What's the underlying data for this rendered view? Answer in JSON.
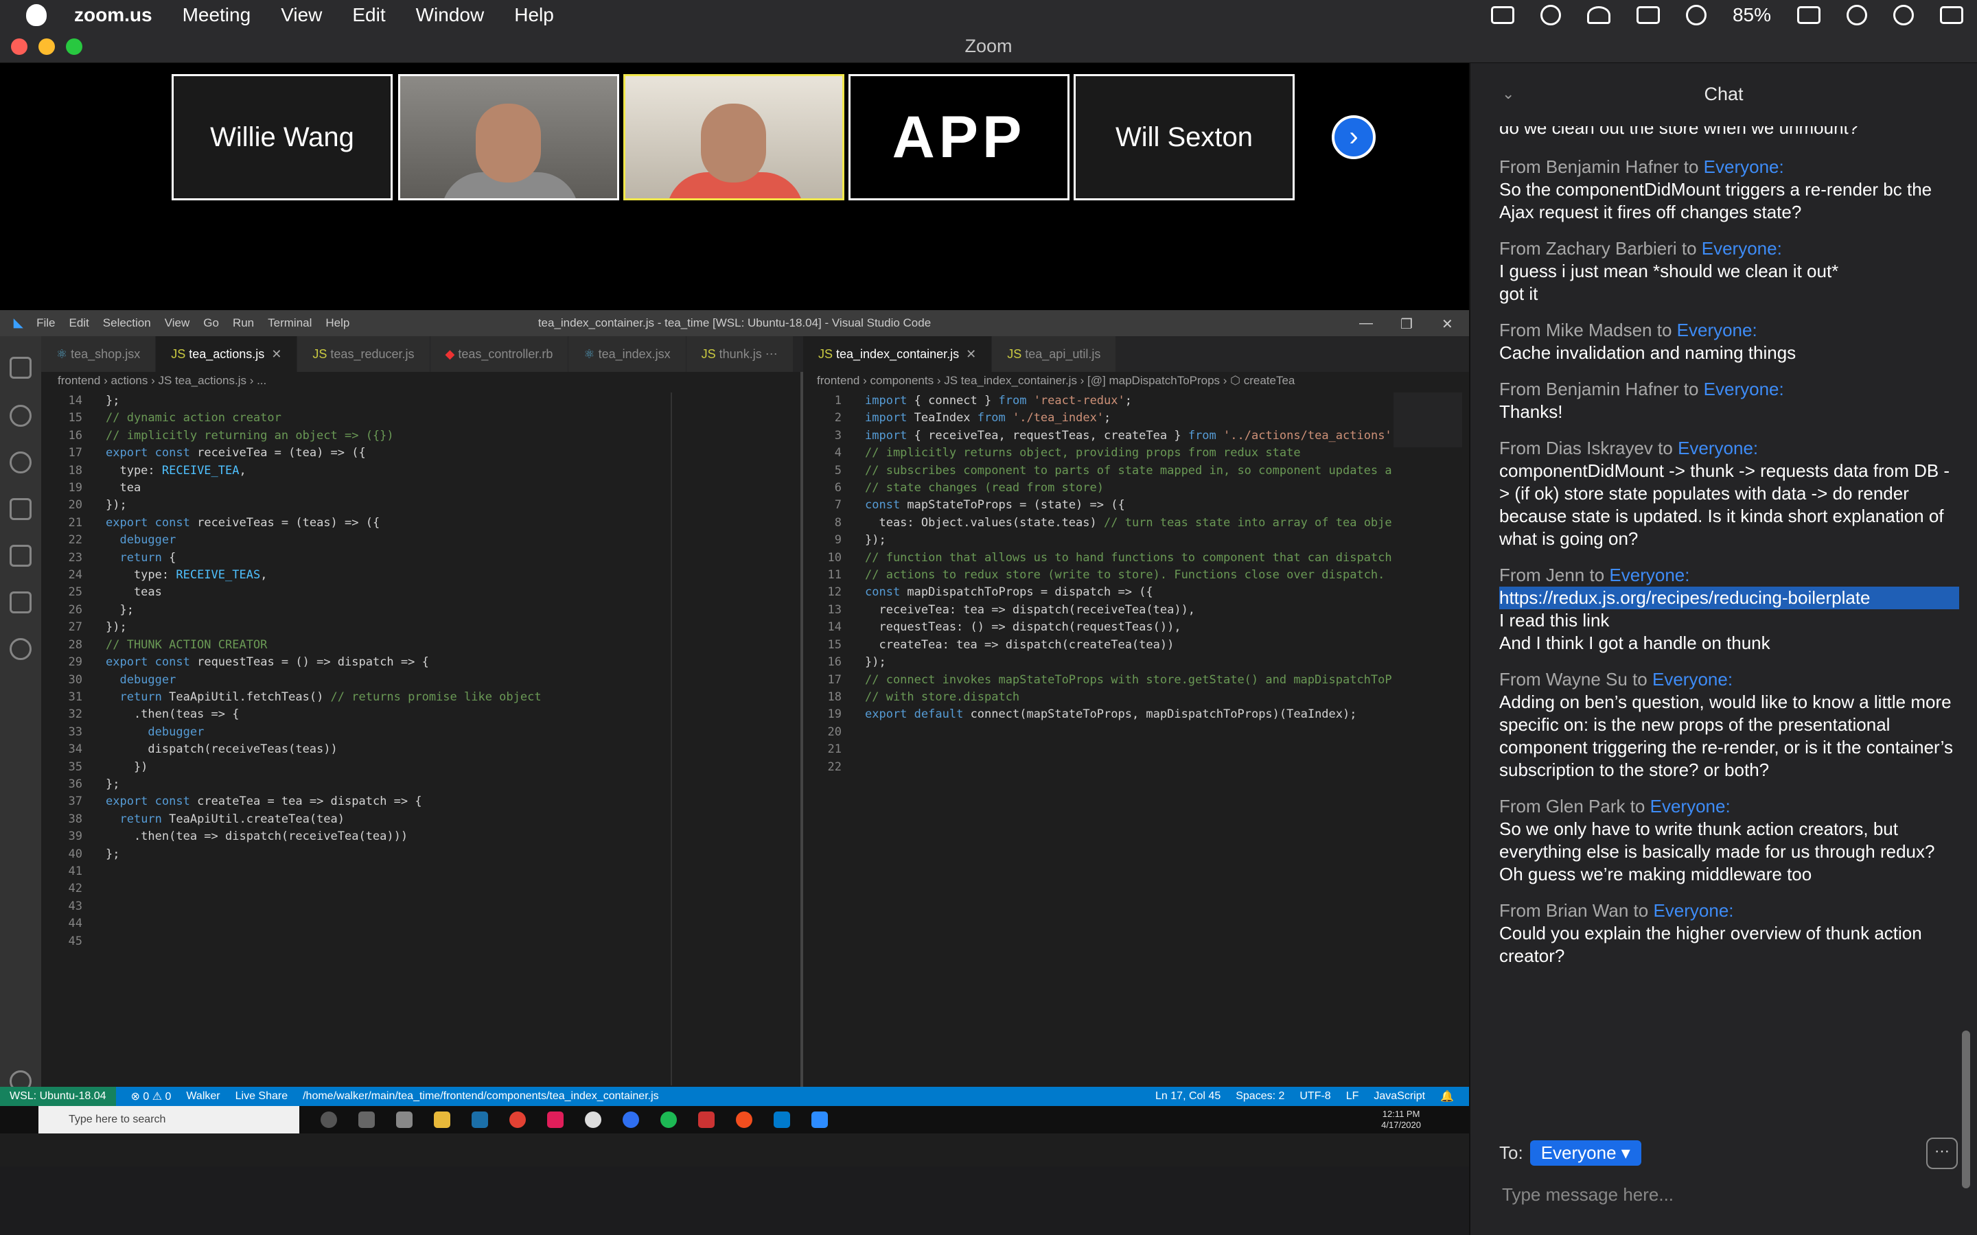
{
  "menubar": {
    "app": "zoom.us",
    "items": [
      "Meeting",
      "View",
      "Edit",
      "Window",
      "Help"
    ],
    "battery": "85%"
  },
  "window": {
    "title": "Zoom"
  },
  "participants": {
    "left": "Willie Wang",
    "right": "Will Sexton"
  },
  "vscode": {
    "menu": [
      "File",
      "Edit",
      "Selection",
      "View",
      "Go",
      "Run",
      "Terminal",
      "Help"
    ],
    "title": "tea_index_container.js - tea_time [WSL: Ubuntu-18.04] - Visual Studio Code",
    "leftTabs": [
      "tea_shop.jsx",
      "tea_actions.js",
      "teas_reducer.js",
      "teas_controller.rb",
      "tea_index.jsx",
      "thunk.js"
    ],
    "rightTabs": [
      "tea_index_container.js",
      "tea_api_util.js"
    ],
    "leftCrumb": "frontend › actions › JS tea_actions.js › ...",
    "rightCrumb": "frontend › components › JS tea_index_container.js › [@] mapDispatchToProps › ⬡ createTea",
    "leftLineStart": 14,
    "leftCode": [
      "};",
      "",
      "// dynamic action creator",
      "// implicitly returning an object => ({})",
      "export const receiveTea = (tea) => ({",
      "  type: RECEIVE_TEA,",
      "  tea",
      "});",
      "",
      "export const receiveTeas = (teas) => ({",
      "  debugger",
      "  return {",
      "    type: RECEIVE_TEAS,",
      "    teas",
      "  };",
      "});",
      "",
      "// THUNK ACTION CREATOR",
      "export const requestTeas = () => dispatch => {",
      "  debugger",
      "  return TeaApiUtil.fetchTeas() // returns promise like object",
      "    .then(teas => {",
      "      debugger",
      "      dispatch(receiveTeas(teas))",
      "    })",
      "};",
      "",
      "export const createTea = tea => dispatch => {",
      "",
      "  return TeaApiUtil.createTea(tea)",
      "    .then(tea => dispatch(receiveTea(tea)))",
      "};"
    ],
    "rightCode": [
      "import { connect } from 'react-redux';",
      "import TeaIndex from './tea_index';",
      "import { receiveTea, requestTeas, createTea } from '../actions/tea_actions'",
      "",
      "// implicitly returns object, providing props from redux state",
      "// subscribes component to parts of state mapped in, so component updates a",
      "// state changes (read from store)",
      "const mapStateToProps = (state) => ({",
      "  teas: Object.values(state.teas) // turn teas state into array of tea obje",
      "});",
      "",
      "// function that allows us to hand functions to component that can dispatch",
      "// actions to redux store (write to store). Functions close over dispatch.",
      "const mapDispatchToProps = dispatch => ({",
      "  receiveTea: tea => dispatch(receiveTea(tea)),",
      "  requestTeas: () => dispatch(requestTeas()),",
      "  createTea: tea => dispatch(createTea(tea))",
      "});",
      "",
      "// connect invokes mapStateToProps with store.getState() and mapDispatchToP",
      "// with store.dispatch",
      "export default connect(mapStateToProps, mapDispatchToProps)(TeaIndex);"
    ],
    "status": {
      "remote": "WSL: Ubuntu-18.04",
      "problems": "⊗ 0 ⚠ 0",
      "user": "Walker",
      "share": "Live Share",
      "path": "/home/walker/main/tea_time/frontend/components/tea_index_container.js",
      "pos": "Ln 17, Col 45",
      "spaces": "Spaces: 2",
      "enc": "UTF-8",
      "eol": "LF",
      "lang": "JavaScript"
    },
    "taskbar": {
      "search": "Type here to search",
      "time": "12:11 PM",
      "date": "4/17/2020"
    }
  },
  "chat": {
    "title": "Chat",
    "topline": "do we clean out the store when we unmount?",
    "messages": [
      {
        "from": "Benjamin Hafner",
        "lines": [
          "So the componentDidMount triggers a re-render bc the Ajax request it fires off changes state?"
        ]
      },
      {
        "from": "Zachary Barbieri",
        "lines": [
          "I guess i just mean *should we clean it out*",
          "got it"
        ]
      },
      {
        "from": "Mike Madsen",
        "lines": [
          "Cache invalidation and naming things"
        ]
      },
      {
        "from": "Benjamin Hafner",
        "lines": [
          "Thanks!"
        ]
      },
      {
        "from": "Dias Iskrayev",
        "lines": [
          "componentDidMount -> thunk -> requests data from DB -> (if ok) store state populates with data -> do render because state is updated. Is it kinda short explanation of what is going on?"
        ]
      },
      {
        "from": "Jenn",
        "link": "https://redux.js.org/recipes/reducing-boilerplate",
        "lines": [
          "I read this link",
          "And I think I got a handle on thunk"
        ]
      },
      {
        "from": "Wayne Su",
        "lines": [
          "Adding on ben’s question, would like to know a little more specific on: is the new props of the presentational component triggering the re-render, or is it the container’s subscription to the store? or both?"
        ]
      },
      {
        "from": "Glen Park",
        "lines": [
          "So we only have to write thunk action creators, but everything else is basically made for us through redux?",
          "Oh guess we’re making middleware too"
        ]
      },
      {
        "from": "Brian Wan",
        "lines": [
          "Could you explain the higher overview of thunk action creator?"
        ]
      }
    ],
    "fromPrefix": "From",
    "toWord": "to",
    "everyone": "Everyone:",
    "toLabel": "To:",
    "recipient": "Everyone",
    "placeholder": "Type message here..."
  }
}
